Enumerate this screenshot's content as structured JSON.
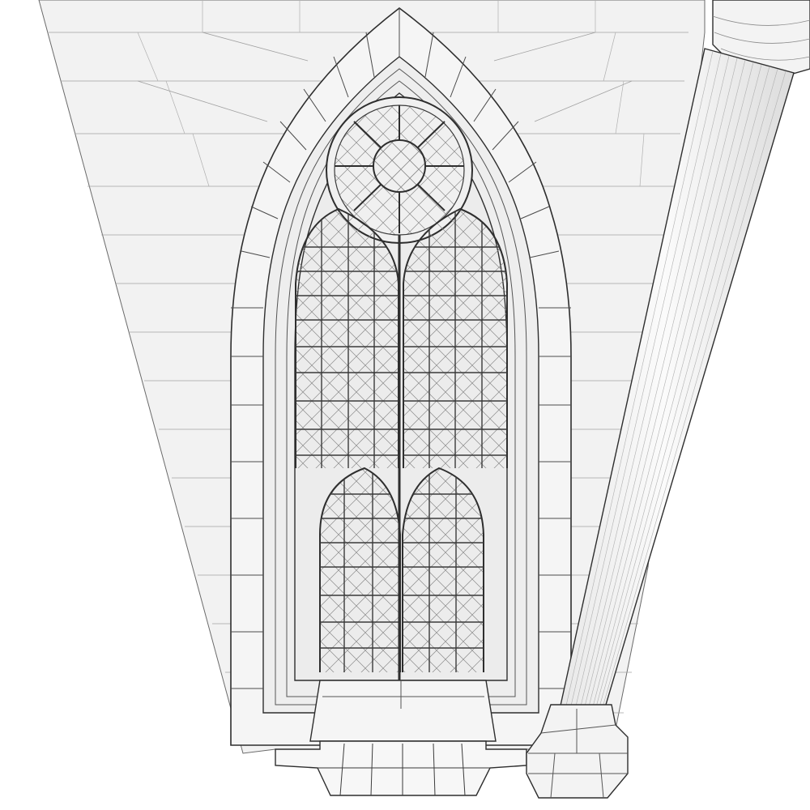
{
  "scene": {
    "subject": "gothic-lancet-window-wireframe-render",
    "palette": {
      "background": "#ffffff",
      "wall": "#f2f2f2",
      "wall_shadow": "#e6e6e6",
      "stone": "#f4f4f4",
      "glass": "#ececec",
      "edge": "#3a3a3a",
      "wire": "#8a8a8a",
      "wire_light": "#b5b5b5"
    }
  }
}
